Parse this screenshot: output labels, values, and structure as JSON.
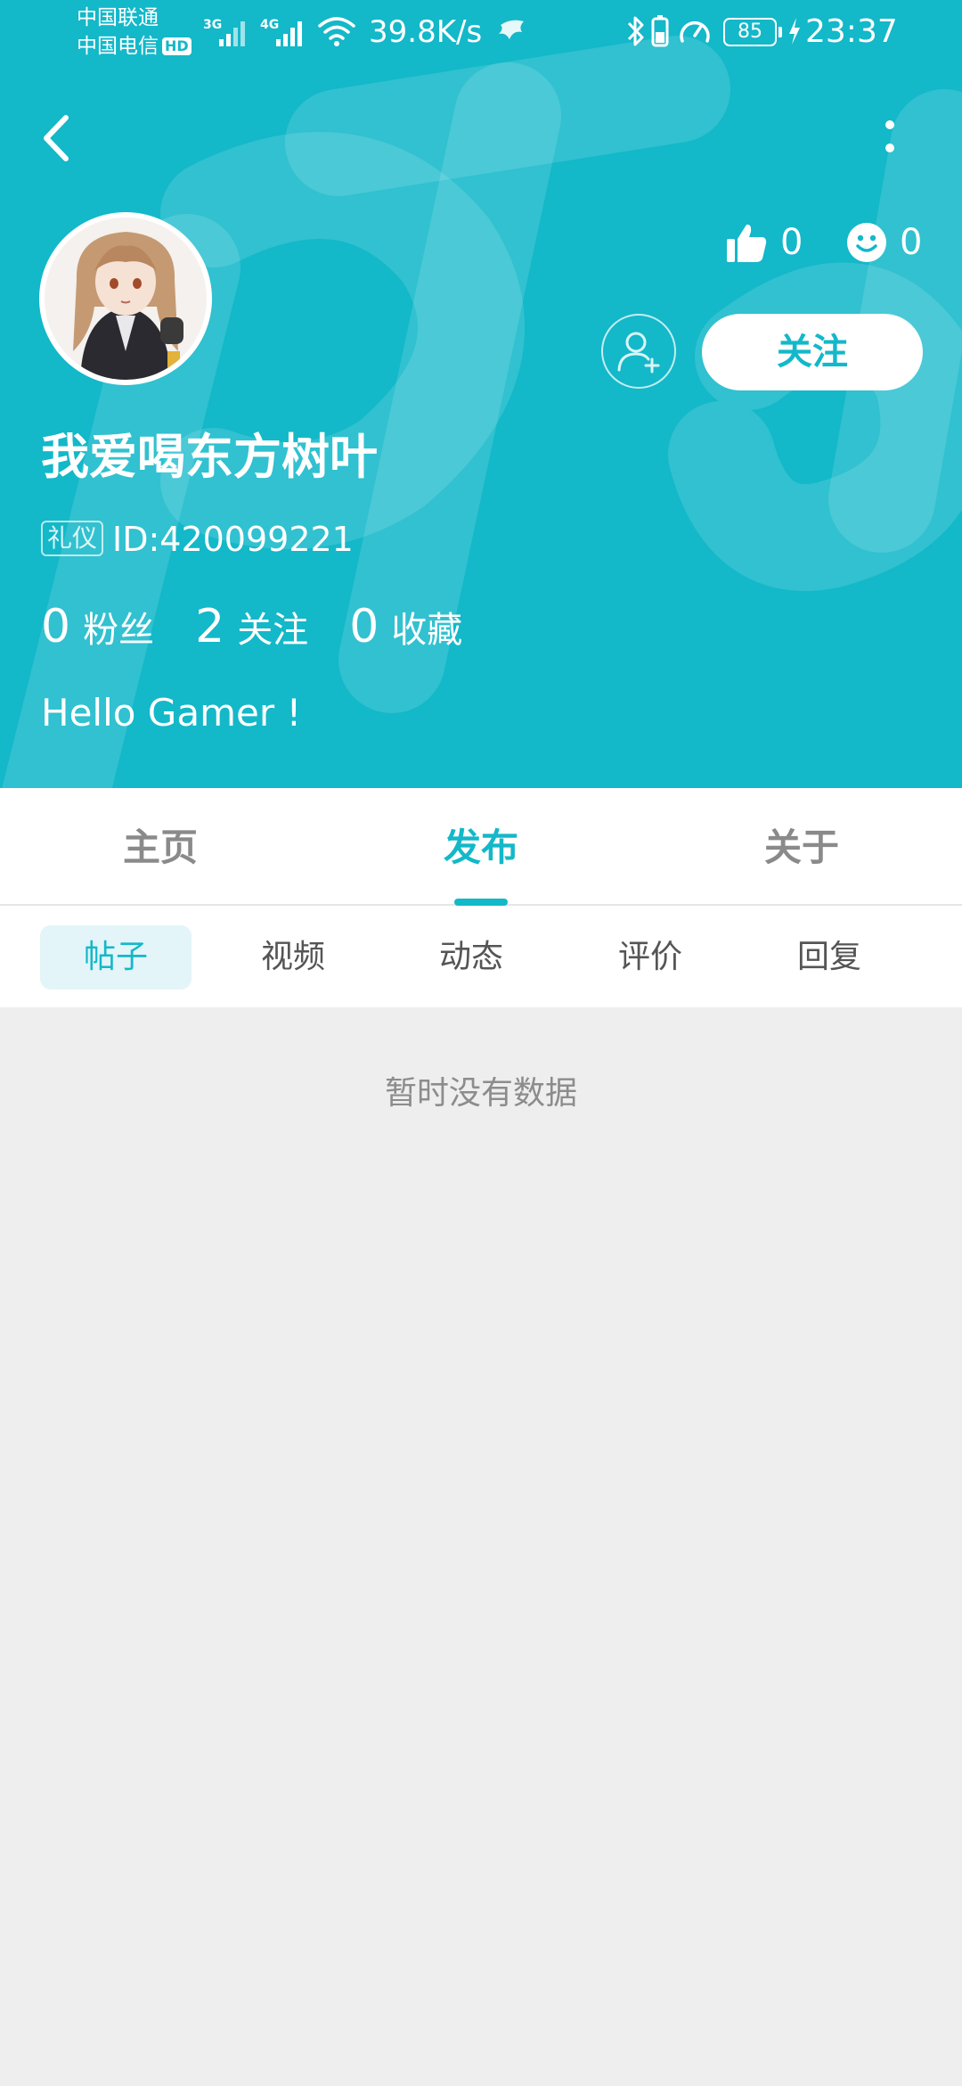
{
  "status_bar": {
    "carrier_1": "中国联通",
    "carrier_2": "中国电信",
    "hd_badge": "HD",
    "net_1": "3G",
    "net_2": "4G",
    "net_speed": "39.8K/s",
    "battery": "85",
    "time": "23:37"
  },
  "profile": {
    "username": "我爱喝东方树叶",
    "role_badge": "礼仪",
    "user_id": "ID:420099221",
    "likes": "0",
    "smiles": "0",
    "follow_label": "关注",
    "bio": "Hello Gamer !",
    "stats": [
      {
        "value": "0",
        "label": "粉丝"
      },
      {
        "value": "2",
        "label": "关注"
      },
      {
        "value": "0",
        "label": "收藏"
      }
    ]
  },
  "tabs": {
    "main": [
      {
        "label": "主页"
      },
      {
        "label": "发布",
        "active": true
      },
      {
        "label": "关于"
      }
    ],
    "sub": [
      {
        "label": "帖子",
        "active": true
      },
      {
        "label": "视频"
      },
      {
        "label": "动态"
      },
      {
        "label": "评价"
      },
      {
        "label": "回复"
      }
    ]
  },
  "content": {
    "empty_message": "暂时没有数据"
  },
  "colors": {
    "accent": "#13b8c9",
    "background": "#eeeeee",
    "muted_text": "#8c8c8c"
  }
}
